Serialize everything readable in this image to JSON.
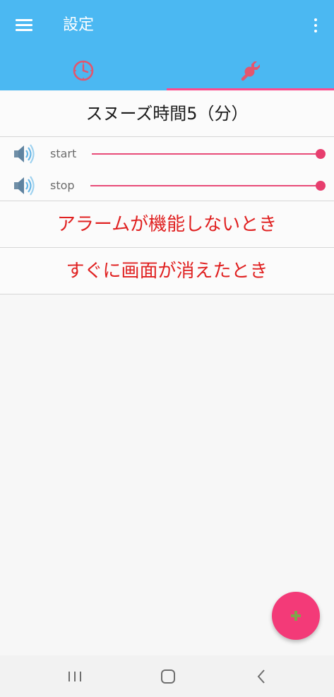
{
  "app_bar": {
    "title": "設定",
    "menu_icon": "hamburger-menu-icon",
    "more_icon": "more-vert-icon",
    "background": "#4bb8f2"
  },
  "tabs": [
    {
      "icon": "clock-icon",
      "selected": false
    },
    {
      "icon": "wrench-icon",
      "selected": true
    }
  ],
  "snooze": {
    "label": "スヌーズ時間5（分）"
  },
  "volume": {
    "start": {
      "label": "start",
      "icon": "speaker-icon",
      "level": 1.0
    },
    "stop": {
      "label": "stop",
      "icon": "speaker-icon",
      "level": 1.0
    }
  },
  "help_links": [
    {
      "label": "アラームが機能しないとき"
    },
    {
      "label": "すぐに画面が消えたとき"
    }
  ],
  "fab": {
    "icon": "plus-icon",
    "color": "#f33a78"
  },
  "nav_bar": {
    "recent": "recent-apps-icon",
    "home": "home-icon",
    "back": "back-icon"
  },
  "colors": {
    "accent": "#ff4a8d",
    "link_text": "#e02121",
    "slider": "#e84b78"
  }
}
